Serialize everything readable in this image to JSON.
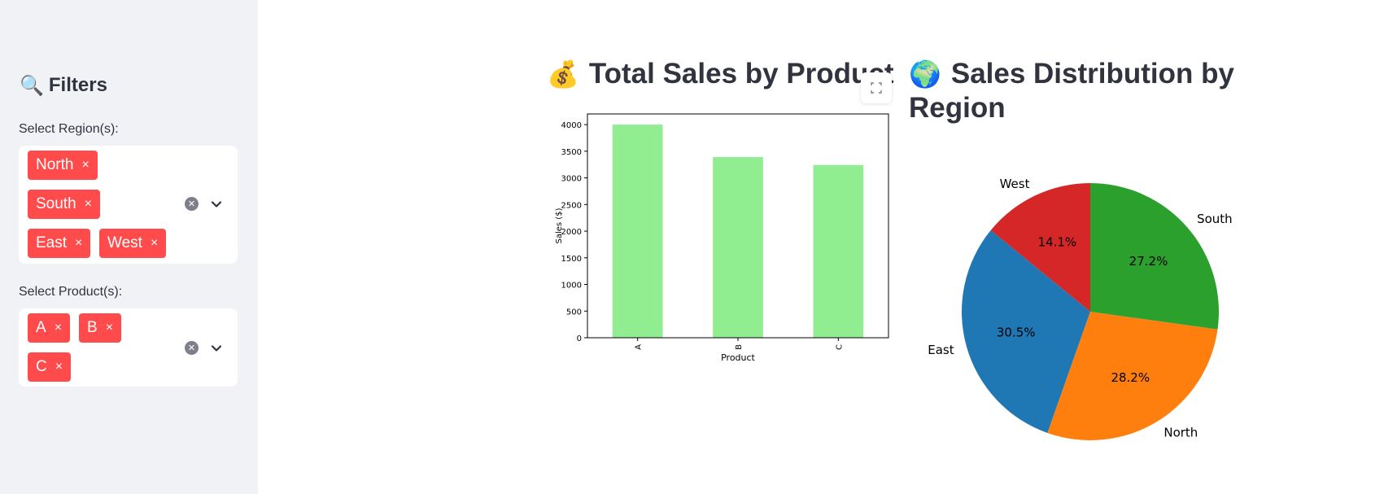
{
  "sidebar": {
    "title_emoji": "🔍",
    "title": "Filters",
    "region_label": "Select Region(s):",
    "regions": [
      "North",
      "South",
      "East",
      "West"
    ],
    "product_label": "Select Product(s):",
    "products": [
      "A",
      "B",
      "C"
    ],
    "chip_remove": "×"
  },
  "main": {
    "bar_title_emoji": "💰",
    "bar_title": "Total Sales by Product",
    "pie_title_emoji": "🌍",
    "pie_title_line1": "Sales Distribution by",
    "pie_title_line2": "Region"
  },
  "colors": {
    "chip": "#ff4b4b",
    "bar": "#90ee90",
    "east": "#1f77b4",
    "north": "#ff7f0e",
    "south": "#2ca02c",
    "west": "#d62728"
  },
  "chart_data": [
    {
      "type": "bar",
      "categories": [
        "A",
        "B",
        "C"
      ],
      "values": [
        4000,
        3390,
        3240
      ],
      "xlabel": "Product",
      "ylabel": "Sales ($)",
      "ylim": [
        0,
        4200
      ],
      "yticks": [
        0,
        500,
        1000,
        1500,
        2000,
        2500,
        3000,
        3500,
        4000
      ],
      "grid": false
    },
    {
      "type": "pie",
      "slices": [
        {
          "label": "West",
          "percent": 14.1,
          "pct_label": "14.1%",
          "color": "#d62728"
        },
        {
          "label": "East",
          "percent": 30.5,
          "pct_label": "30.5%",
          "color": "#1f77b4"
        },
        {
          "label": "North",
          "percent": 28.2,
          "pct_label": "28.2%",
          "color": "#ff7f0e"
        },
        {
          "label": "South",
          "percent": 27.2,
          "pct_label": "27.2%",
          "color": "#2ca02c"
        }
      ],
      "start_angle": 90,
      "direction": "counterclockwise"
    }
  ]
}
